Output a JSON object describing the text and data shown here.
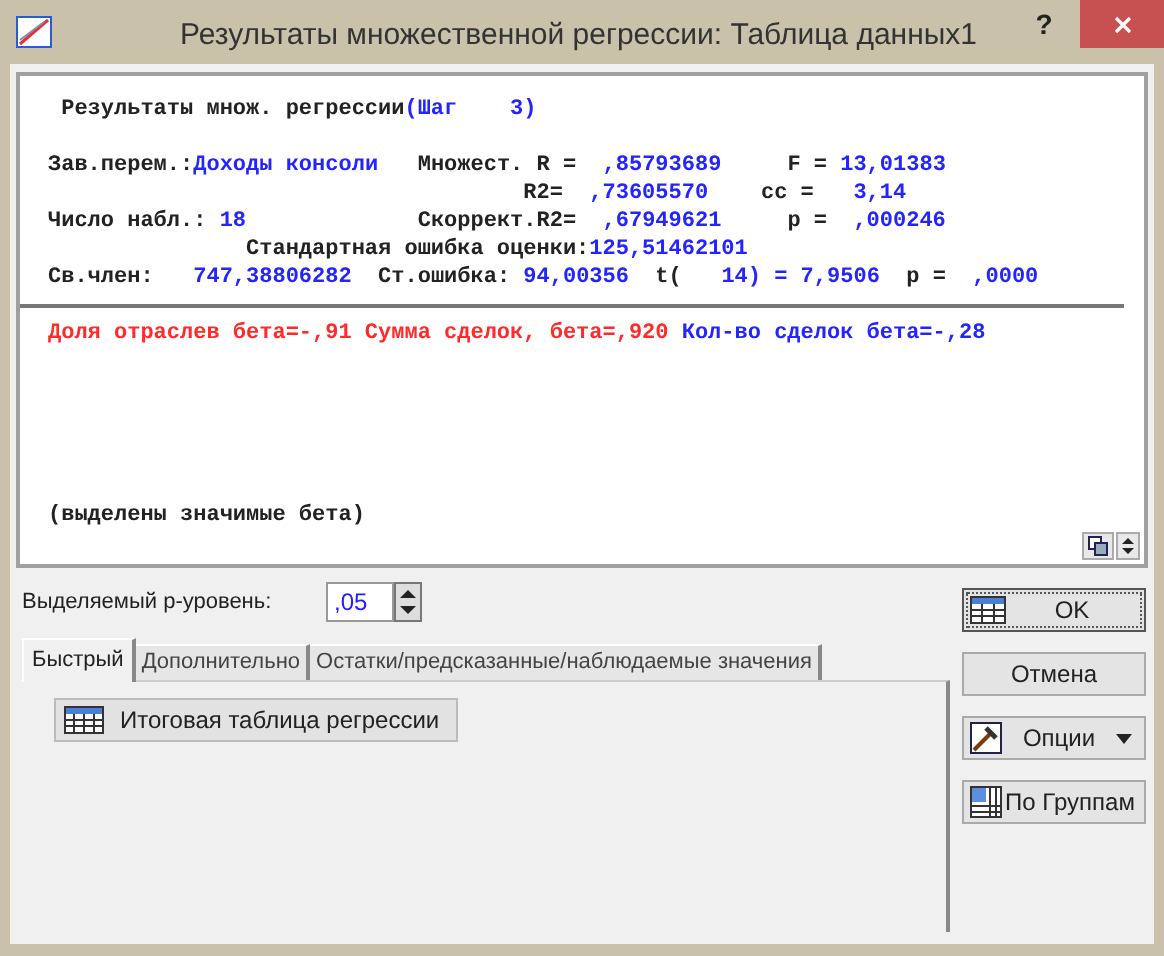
{
  "window": {
    "title": "Результаты множественной регрессии: Таблица данных1",
    "buttons": [
      "?"
    ]
  },
  "report": {
    "lines": [
      [
        {
          "text": " Результаты множ. регрессии",
          "kind": "label"
        },
        {
          "text": "(Шаг    3)",
          "kind": "value"
        }
      ],
      [
        {
          "text": "Зав.перем.:",
          "kind": "label"
        },
        {
          "text": "Доходы консоли",
          "kind": "value"
        },
        {
          "text": "   Множест. R =  ",
          "kind": "label"
        },
        {
          "text": ",85793689",
          "kind": "value"
        },
        {
          "text": "     F = ",
          "kind": "label"
        },
        {
          "text": "13,01383",
          "kind": "value"
        }
      ],
      [
        {
          "text": "                                    R2=  ",
          "kind": "label"
        },
        {
          "text": ",73605570",
          "kind": "value"
        },
        {
          "text": "    cc =   ",
          "kind": "label"
        },
        {
          "text": "3,14",
          "kind": "value"
        }
      ],
      [
        {
          "text": "Число набл.: ",
          "kind": "label"
        },
        {
          "text": "18",
          "kind": "value"
        },
        {
          "text": "             Скоррект.R2=  ",
          "kind": "label"
        },
        {
          "text": ",67949621",
          "kind": "value"
        },
        {
          "text": "     p =  ",
          "kind": "label"
        },
        {
          "text": ",000246",
          "kind": "value"
        }
      ],
      [
        {
          "text": "               Стандартная ошибка оценки:",
          "kind": "label"
        },
        {
          "text": "125,51462101",
          "kind": "value"
        }
      ],
      [
        {
          "text": "Св.член:   ",
          "kind": "label"
        },
        {
          "text": "747,38806282",
          "kind": "value"
        },
        {
          "text": "  Ст.ошибка: ",
          "kind": "label"
        },
        {
          "text": "94,00356",
          "kind": "value"
        },
        {
          "text": "  t(   ",
          "kind": "label"
        },
        {
          "text": "14) = 7,9506",
          "kind": "value"
        },
        {
          "text": "  p =  ",
          "kind": "label"
        },
        {
          "text": ",0000",
          "kind": "value"
        }
      ]
    ],
    "betas": [
      {
        "text": "Доля отраслев бета=-,91 Сумма сделок, бета=,920 ",
        "kind": "significant"
      },
      {
        "text": "Кол-во сделок бета=-,28",
        "kind": "value"
      }
    ],
    "footnote": "(выделены значимые бета)"
  },
  "p_level": {
    "label": "Выделяемый p-уровень:",
    "value": ",05"
  },
  "tabs": [
    {
      "label": "Быстрый",
      "selected": true
    },
    {
      "label": "Дополнительно",
      "selected": false
    },
    {
      "label": "Остатки/предсказанные/наблюдаемые значения",
      "selected": false
    }
  ],
  "tab_buttons": [
    "Итоговая таблица регрессии"
  ],
  "side_buttons": [
    {
      "label": "OK",
      "kind": "table"
    },
    {
      "label": "Отмена",
      "kind": "plain"
    },
    {
      "label": "Опции",
      "kind": "menu"
    },
    {
      "label": "По Группам",
      "kind": "groups"
    }
  ]
}
